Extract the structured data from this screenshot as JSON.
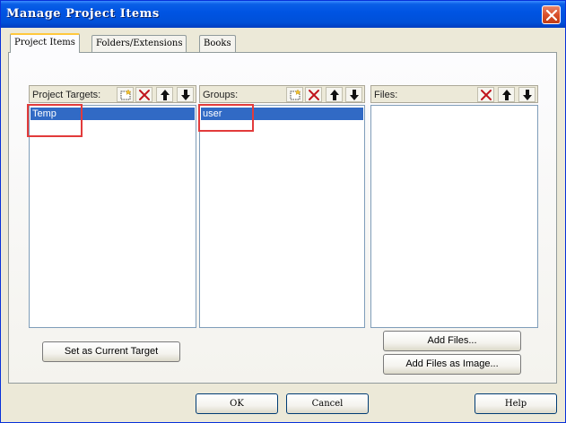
{
  "window": {
    "title": "Manage Project Items"
  },
  "tabs": [
    {
      "label": "Project Items",
      "active": true
    },
    {
      "label": "Folders/Extensions",
      "active": false
    },
    {
      "label": "Books",
      "active": false
    }
  ],
  "panes": {
    "targets": {
      "label": "Project Targets:",
      "items": [
        "Temp"
      ],
      "selected": "Temp"
    },
    "groups": {
      "label": "Groups:",
      "items": [
        "user"
      ],
      "selected": "user"
    },
    "files": {
      "label": "Files:",
      "items": []
    }
  },
  "buttons": {
    "set_current_target": "Set as Current Target",
    "add_files": "Add Files...",
    "add_files_as_image": "Add Files as Image...",
    "ok": "OK",
    "cancel": "Cancel",
    "help": "Help"
  },
  "toolbar_icons": [
    "new-icon",
    "delete-icon",
    "move-up-icon",
    "move-down-icon"
  ],
  "colors": {
    "accent": "#316ac5",
    "highlight_box": "#e23b3b",
    "titlebar": "#0054e3"
  }
}
